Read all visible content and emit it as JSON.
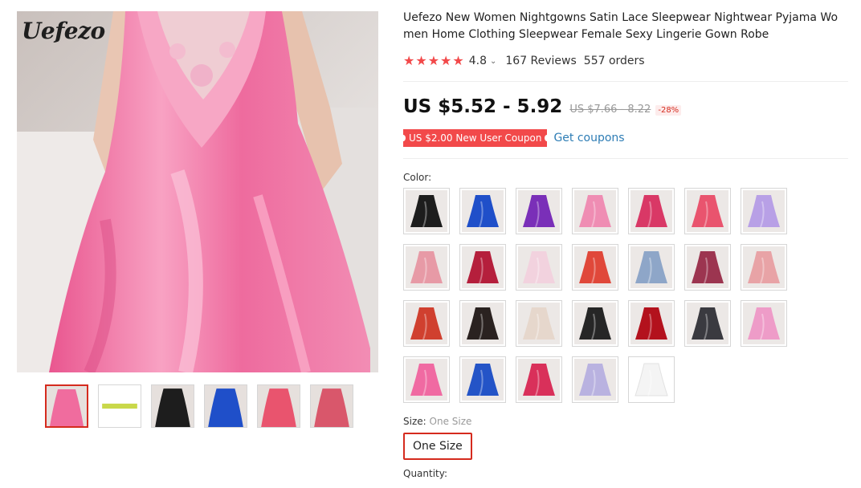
{
  "brand": "Uefezo",
  "product": {
    "title": "Uefezo New Women Nightgowns Satin Lace Sleepwear Nightwear Pyjama Women Home Clothing Sleepwear Female Sexy Lingerie Gown Robe",
    "rating": "4.8",
    "rating_stars": 5,
    "reviews": "167 Reviews",
    "orders": "557 orders"
  },
  "price": {
    "current": "US $5.52 - 5.92",
    "original": "US $7.66 - 8.22",
    "discount": "-28%"
  },
  "coupon": {
    "badge": "US $2.00 New User Coupon",
    "link": "Get coupons"
  },
  "color": {
    "label": "Color:",
    "swatches": [
      {
        "name": "black",
        "color": "#1d1d1d"
      },
      {
        "name": "royal-blue",
        "color": "#1f4fc9"
      },
      {
        "name": "purple",
        "color": "#7a2fb8"
      },
      {
        "name": "light-pink",
        "color": "#ef8db3"
      },
      {
        "name": "rose-red",
        "color": "#d93866"
      },
      {
        "name": "watermelon",
        "color": "#e9546e"
      },
      {
        "name": "lavender",
        "color": "#b8a0e6"
      },
      {
        "name": "dusty-pink",
        "color": "#e79aa6"
      },
      {
        "name": "wine-red",
        "color": "#b51f3c"
      },
      {
        "name": "pale-pink",
        "color": "#f2d2de"
      },
      {
        "name": "coral-red",
        "color": "#e0483a"
      },
      {
        "name": "grey-blue",
        "color": "#8ea6c8"
      },
      {
        "name": "burgundy-lace",
        "color": "#9c3550"
      },
      {
        "name": "nude-pink",
        "color": "#e8a3a6"
      },
      {
        "name": "red-chemise",
        "color": "#d0402f"
      },
      {
        "name": "black-lace",
        "color": "#2a2220"
      },
      {
        "name": "champagne",
        "color": "#e6d7cc"
      },
      {
        "name": "black-slip",
        "color": "#262626"
      },
      {
        "name": "red-slip",
        "color": "#b3121d"
      },
      {
        "name": "charcoal",
        "color": "#3a3a40"
      },
      {
        "name": "pink-slip",
        "color": "#ee9cc8"
      },
      {
        "name": "hot-pink",
        "color": "#f06aa2"
      },
      {
        "name": "blue-satin",
        "color": "#2454c7"
      },
      {
        "name": "rose-satin",
        "color": "#d9305a"
      },
      {
        "name": "lilac",
        "color": "#b9b2e0"
      },
      {
        "name": "white",
        "color": "#f4f4f4"
      }
    ]
  },
  "size": {
    "label": "Size:",
    "selected": "One Size",
    "options": [
      "One Size"
    ]
  },
  "quantity": {
    "label": "Quantity:"
  },
  "gallery": {
    "main_color": "#f06c9e",
    "thumbs": [
      {
        "color": "#f06c9e"
      },
      {
        "color": "#c9d84a"
      },
      {
        "color": "#1d1d1d"
      },
      {
        "color": "#1f4fc9"
      },
      {
        "color": "#e9546e"
      },
      {
        "color": "#d9576b"
      }
    ]
  }
}
